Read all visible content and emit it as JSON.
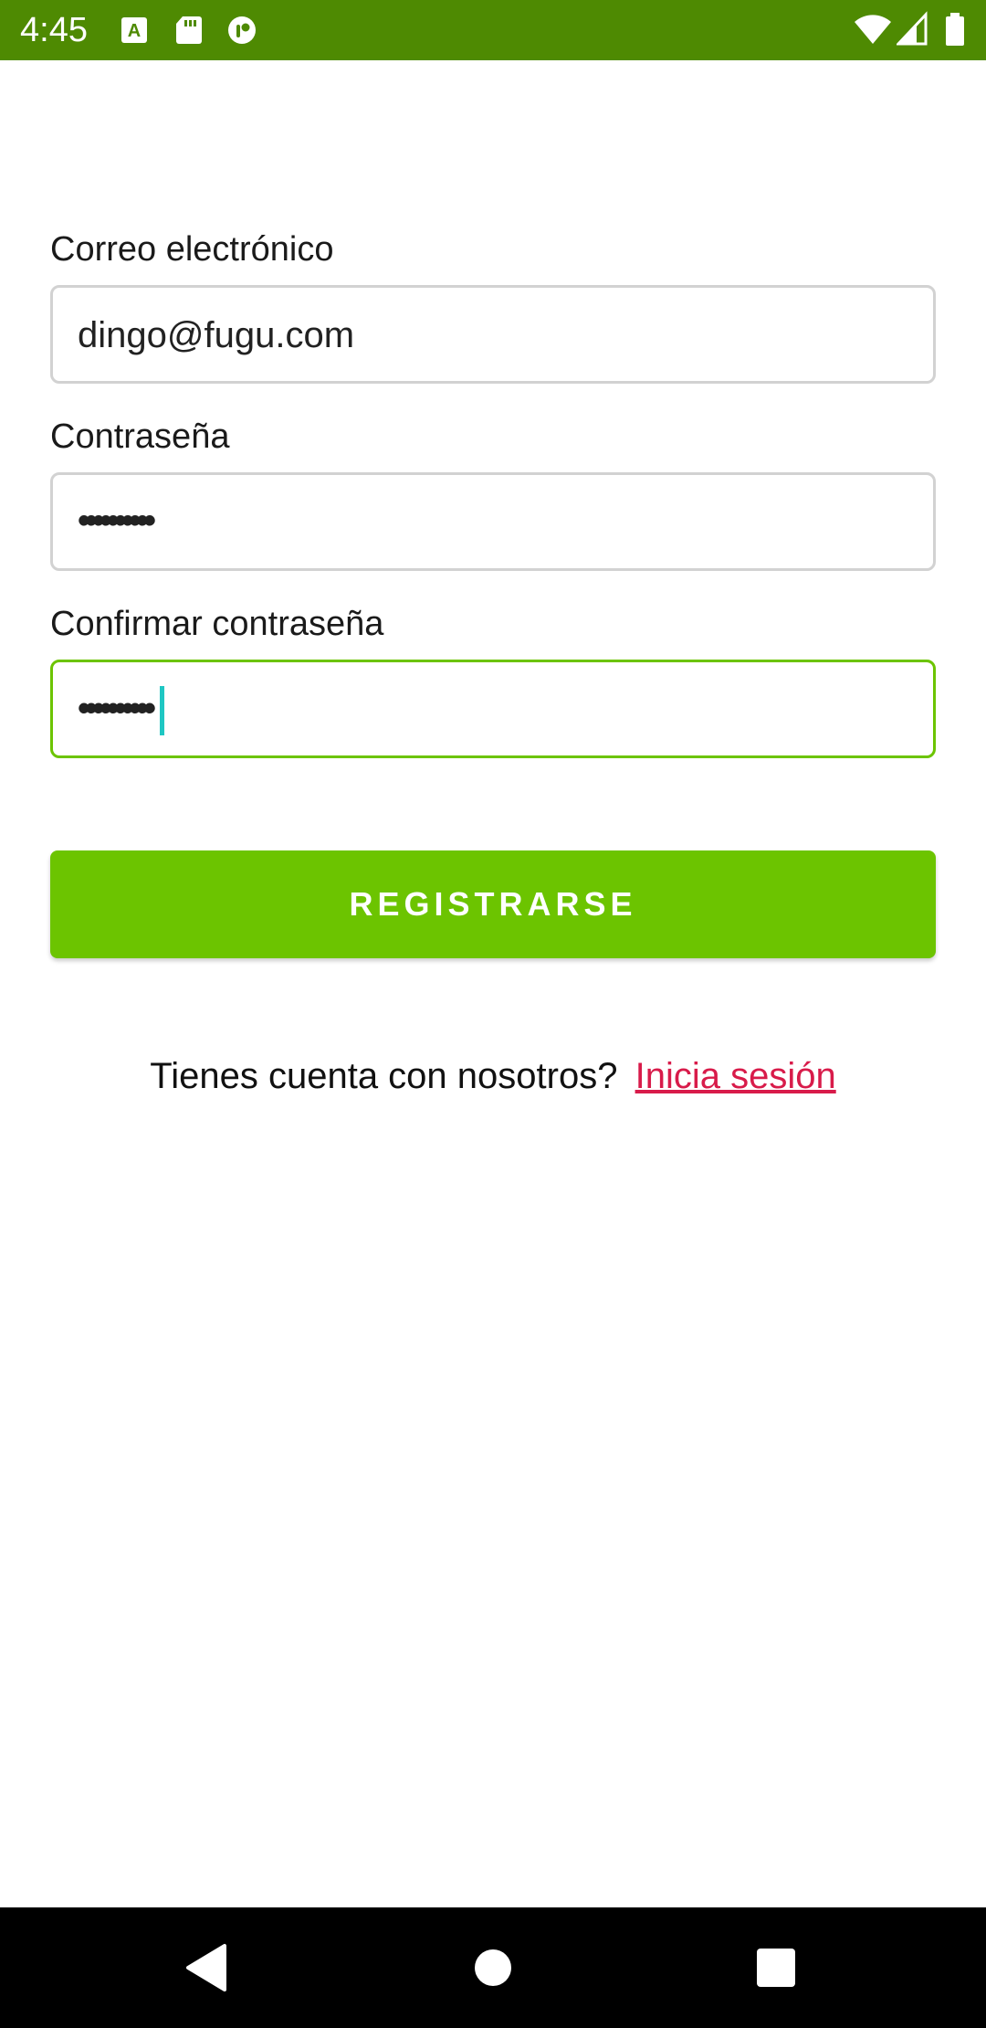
{
  "status_bar": {
    "time": "4:45",
    "background": "#4e8a02",
    "left_icons": [
      "text-a-icon",
      "sd-card-icon",
      "app-icon"
    ],
    "right_icons": [
      "wifi-icon",
      "signal-icon",
      "battery-icon"
    ]
  },
  "form": {
    "email": {
      "label": "Correo electrónico",
      "value": "dingo@fugu.com"
    },
    "password": {
      "label": "Contraseña",
      "value": "••••••••••"
    },
    "confirm_password": {
      "label": "Confirmar contraseña",
      "value": "••••••••••",
      "focused": true
    }
  },
  "submit_button": {
    "label": "REGISTRARSE",
    "color": "#6cc400"
  },
  "signin": {
    "prompt": "Tienes cuenta con nosotros?",
    "link": "Inicia sesión",
    "link_color": "#d81b4a"
  },
  "nav_bar": {
    "buttons": [
      "back-icon",
      "home-icon",
      "recents-icon"
    ]
  }
}
